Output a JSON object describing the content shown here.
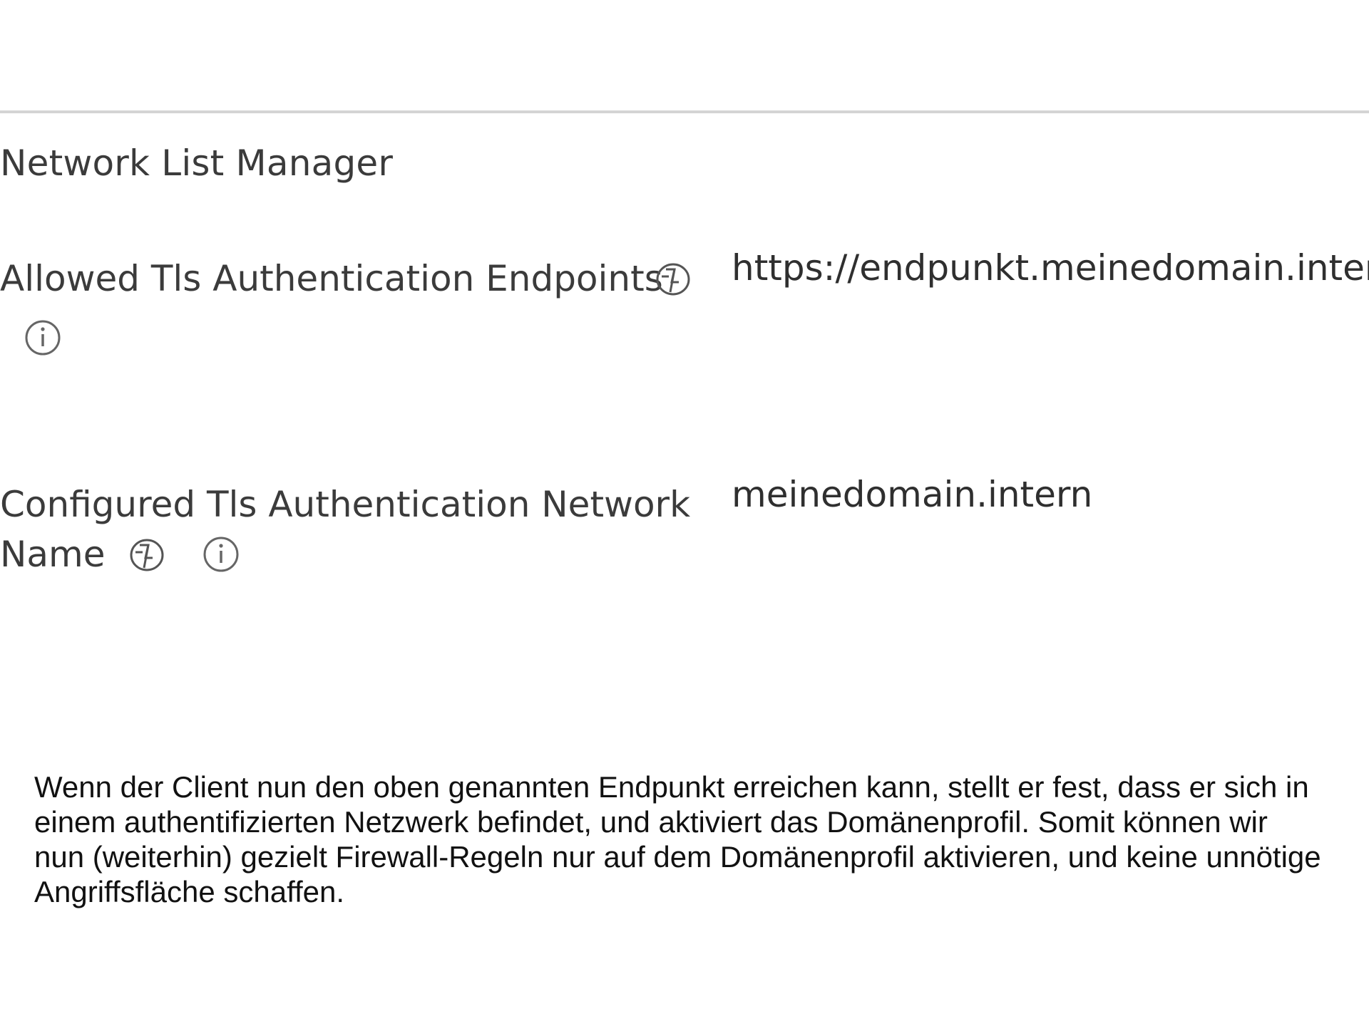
{
  "section": {
    "title": "Network List Manager"
  },
  "settings": [
    {
      "label_line1": "Allowed Tls Authentication Endpoints",
      "value": "https://endpunkt.meinedomain.intern",
      "icons": [
        "csp-policy-icon",
        "info-icon"
      ]
    },
    {
      "label_line1": "Configured Tls Authentication Network",
      "label_line2": "Name",
      "value": "meinedomain.intern",
      "icons": [
        "csp-policy-icon",
        "info-icon"
      ]
    }
  ],
  "article": {
    "lines": [
      "Wenn der Client nun den oben genannten Endpunkt erreichen kann, stellt er fest, dass er sich in",
      "einem authentifizierten Netzwerk befindet, und aktiviert das Domänenprofil. Somit können wir",
      "nun (weiterhin) gezielt Firewall-Regeln nur auf dem Domänenprofil aktivieren, und keine unnötige",
      "Angriffsfläche schaffen."
    ]
  }
}
